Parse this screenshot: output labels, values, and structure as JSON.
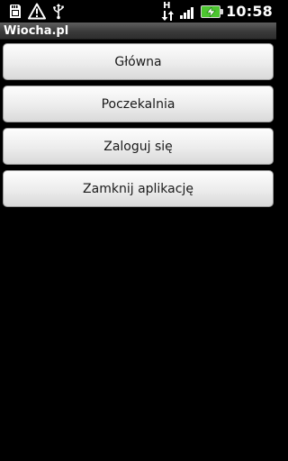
{
  "status_bar": {
    "icons": [
      "sd-card-icon",
      "warning-icon",
      "usb-icon"
    ],
    "network_type": "H",
    "signal_bars": 4,
    "battery_color": "#4cc62f",
    "time": "10:58"
  },
  "title_bar": {
    "title": "Wiocha.pl"
  },
  "menu": {
    "buttons": [
      {
        "label": "Główna"
      },
      {
        "label": "Poczekalnia"
      },
      {
        "label": "Zaloguj się"
      },
      {
        "label": "Zamknij aplikację"
      }
    ]
  }
}
